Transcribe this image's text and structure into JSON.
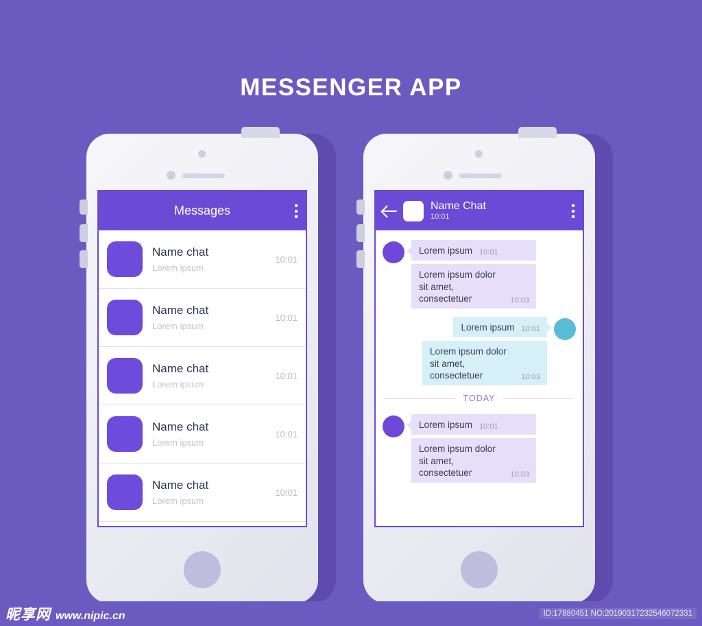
{
  "page": {
    "title": "MESSENGER APP",
    "background_color": "#6b5bc0",
    "accent_color": "#6b4bd6"
  },
  "phones": {
    "left": {
      "appbar": {
        "title": "Messages",
        "menu_icon": "kebab-menu-icon"
      },
      "conversations": [
        {
          "name": "Name chat",
          "preview": "Lorem ipsum",
          "time": "10:01"
        },
        {
          "name": "Name chat",
          "preview": "Lorem ipsum",
          "time": "10:01"
        },
        {
          "name": "Name chat",
          "preview": "Lorem ipsum",
          "time": "10:01"
        },
        {
          "name": "Name chat",
          "preview": "Lorem ipsum",
          "time": "10:01"
        },
        {
          "name": "Name chat",
          "preview": "Lorem ipsum",
          "time": "10:01"
        }
      ]
    },
    "right": {
      "appbar": {
        "back_icon": "back-arrow-icon",
        "name": "Name Chat",
        "time": "10:01",
        "menu_icon": "kebab-menu-icon"
      },
      "divider_label": "TODAY",
      "groups": [
        {
          "direction": "incoming",
          "avatar_color": "#7048d8",
          "messages": [
            {
              "text": "Lorem ipsum",
              "time": "10:01"
            },
            {
              "text": "Lorem ipsum dolor sit amet, consectetuer",
              "time": "10:03"
            }
          ]
        },
        {
          "direction": "outgoing",
          "avatar_color": "#5bbcd5",
          "messages": [
            {
              "text": "Lorem ipsum",
              "time": "10:01"
            },
            {
              "text": "Lorem ipsum dolor sit amet, consectetuer",
              "time": "10:03"
            }
          ]
        },
        {
          "direction": "incoming",
          "avatar_color": "#7048d8",
          "messages": [
            {
              "text": "Lorem ipsum",
              "time": "10:01"
            },
            {
              "text": "Lorem ipsum dolor sit amet, consectetuer",
              "time": "10:03"
            }
          ]
        }
      ]
    }
  },
  "footer": {
    "brand_cn": "昵享网",
    "brand_url": "www.nipic.cn",
    "id_text": "ID:17880451 NO:20190317232546072331"
  }
}
